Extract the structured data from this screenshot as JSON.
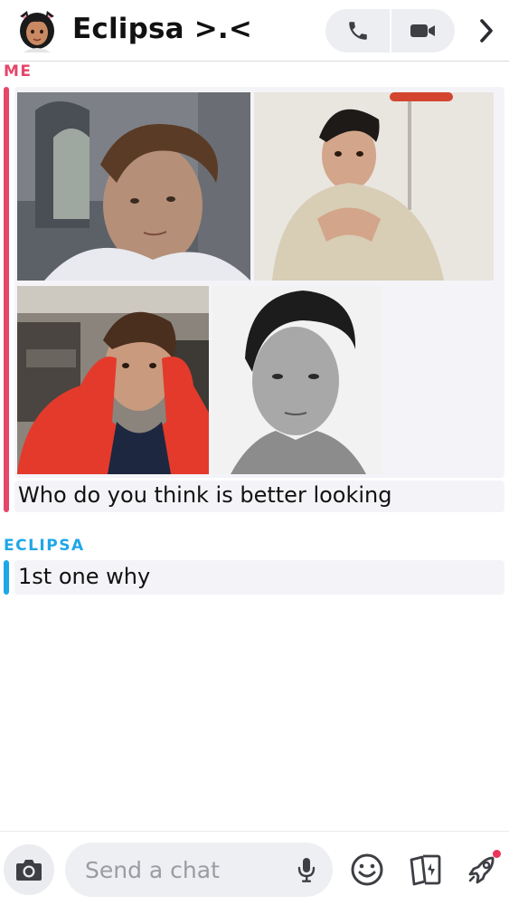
{
  "header": {
    "title": "Eclipsa >.<",
    "actions": [
      "phone-icon",
      "video-camera-icon",
      "chevron-right-icon"
    ]
  },
  "conversation": {
    "me": {
      "sender_label": "ME",
      "color": "#e5466a",
      "photos": [
        "photo-1",
        "photo-2",
        "photo-3",
        "photo-4"
      ],
      "message": "Who do you think is better looking"
    },
    "eclipsa": {
      "sender_label": "ECLIPSA",
      "color": "#1ea7e8",
      "message": "1st one why"
    }
  },
  "composer": {
    "placeholder": "Send a chat",
    "icons": [
      "camera-icon",
      "microphone-icon",
      "smiley-icon",
      "cards-icon",
      "rocket-icon"
    ],
    "notification_color": "#ec3358"
  }
}
